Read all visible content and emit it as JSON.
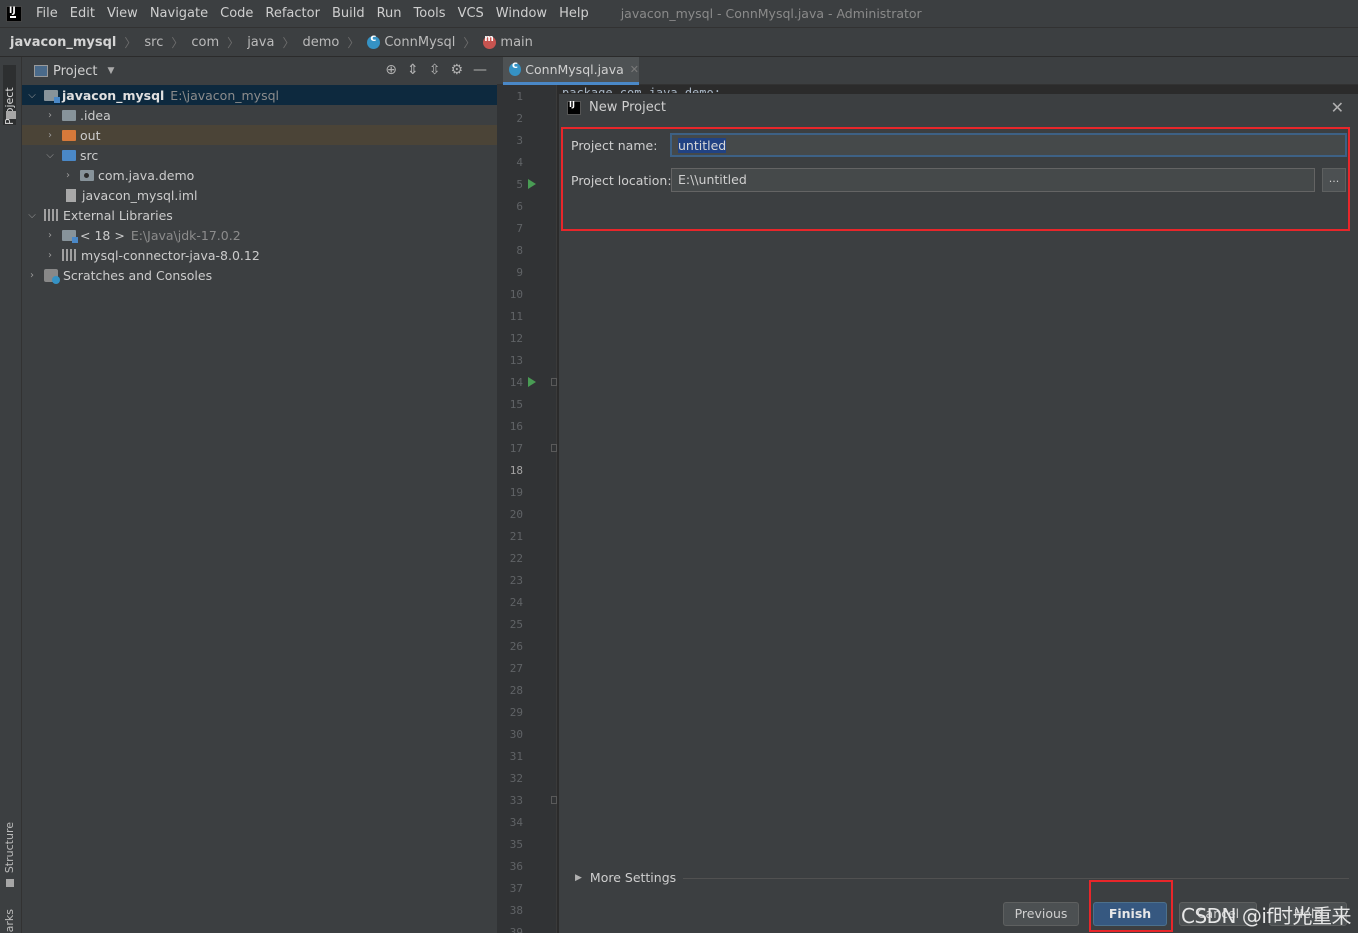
{
  "menubar": {
    "items": [
      "File",
      "Edit",
      "View",
      "Navigate",
      "Code",
      "Refactor",
      "Build",
      "Run",
      "Tools",
      "VCS",
      "Window",
      "Help"
    ],
    "window_title": "javacon_mysql - ConnMysql.java - Administrator"
  },
  "breadcrumbs": [
    "javacon_mysql",
    "src",
    "com",
    "java",
    "demo",
    "ConnMysql",
    "main"
  ],
  "toolstrip": {
    "project_tab": "Project",
    "structure_tab": "Structure",
    "bookmarks_tab": "arks"
  },
  "project_panel": {
    "title": "Project",
    "tree": [
      {
        "label": "javacon_mysql",
        "detail": "E:\\javacon_mysql"
      },
      {
        "label": ".idea"
      },
      {
        "label": "out"
      },
      {
        "label": "src"
      },
      {
        "label": "com.java.demo"
      },
      {
        "label": "javacon_mysql.iml"
      },
      {
        "label": "External Libraries"
      },
      {
        "label": "< 18 >",
        "detail": "E:\\Java\\jdk-17.0.2"
      },
      {
        "label": "mysql-connector-java-8.0.12"
      },
      {
        "label": "Scratches and Consoles"
      }
    ]
  },
  "editor": {
    "tab_label": "ConnMysql.java",
    "code_peek": "package com.java.demo;",
    "line_numbers": [
      "1",
      "2",
      "3",
      "4",
      "5",
      "6",
      "7",
      "8",
      "9",
      "10",
      "11",
      "12",
      "13",
      "14",
      "15",
      "16",
      "17",
      "18",
      "19",
      "20",
      "21",
      "22",
      "23",
      "24",
      "25",
      "26",
      "27",
      "28",
      "29",
      "30",
      "31",
      "32",
      "33",
      "34",
      "35",
      "36",
      "37",
      "38",
      "39"
    ]
  },
  "dialog": {
    "title": "New Project",
    "project_name_label": "Project name:",
    "project_name_value": "untitled",
    "project_location_label": "Project location:",
    "project_location_value": "E:\\\\untitled",
    "browse_label": "...",
    "more_settings_label": "More Settings",
    "previous_label": "Previous",
    "finish_label": "Finish",
    "cancel_label": "Cancel",
    "help_label": "Help"
  },
  "watermark": "CSDN @if时光重来",
  "colors": {
    "highlight_box": "#e8262a",
    "primary_button": "#365880",
    "selection": "#214283"
  }
}
